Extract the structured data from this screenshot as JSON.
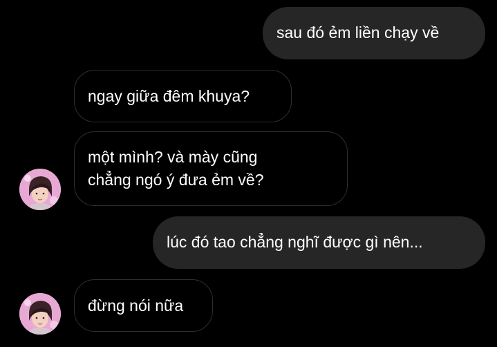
{
  "thread": {
    "messages": [
      {
        "sender": "me",
        "text": "sau đó ẻm liền chạy về"
      },
      {
        "sender": "them",
        "text": "ngay giữa đêm khuya?"
      },
      {
        "sender": "them",
        "lines": [
          "một mình? và mày cũng",
          "chẳng ngó ý đưa ẻm về?"
        ]
      },
      {
        "sender": "me",
        "text": "lúc đó tao chẳng nghĩ được gì nên..."
      },
      {
        "sender": "them",
        "text": "đừng nói nữa"
      }
    ]
  },
  "colors": {
    "background": "#000000",
    "sent_bubble": "#262626",
    "received_border": "#2e2e2e",
    "text": "#ffffff",
    "avatar_accent": "#e49ccc"
  },
  "icons": {
    "avatar": "profile-photo"
  }
}
